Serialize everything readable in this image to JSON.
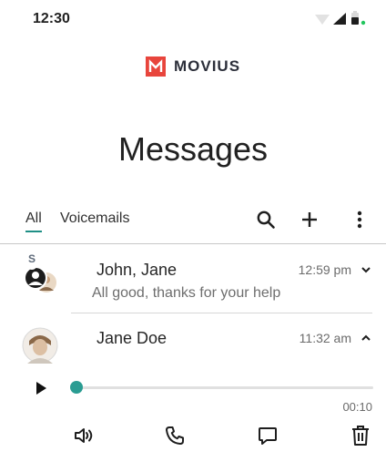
{
  "status_bar": {
    "time": "12:30",
    "icons": [
      "wifi-icon",
      "cellular-signal-icon",
      "battery-icon",
      "notification-dot-icon"
    ],
    "notification_color": "#22c55e"
  },
  "brand": {
    "name": "MOVIUS",
    "logo_color": "#e8453c"
  },
  "page": {
    "title": "Messages"
  },
  "tabs": {
    "items": [
      {
        "label": "All",
        "selected": true
      },
      {
        "label": "Voicemails",
        "selected": false
      }
    ],
    "accent_color": "#1f8f86",
    "actions": [
      "search-icon",
      "add-icon",
      "more-vert-icon"
    ]
  },
  "conversations": [
    {
      "name": "John, Jane",
      "time": "12:59 pm",
      "preview": "All good, thanks for your help",
      "avatar_badge": "S",
      "expanded": false
    },
    {
      "name": "Jane Doe",
      "time": "11:32 am",
      "expanded": true
    }
  ],
  "player": {
    "duration": "00:10",
    "progress": 0.0,
    "accent_color": "#2a9c92"
  },
  "actions": [
    "speaker-icon",
    "phone-icon",
    "message-icon",
    "trash-icon"
  ]
}
